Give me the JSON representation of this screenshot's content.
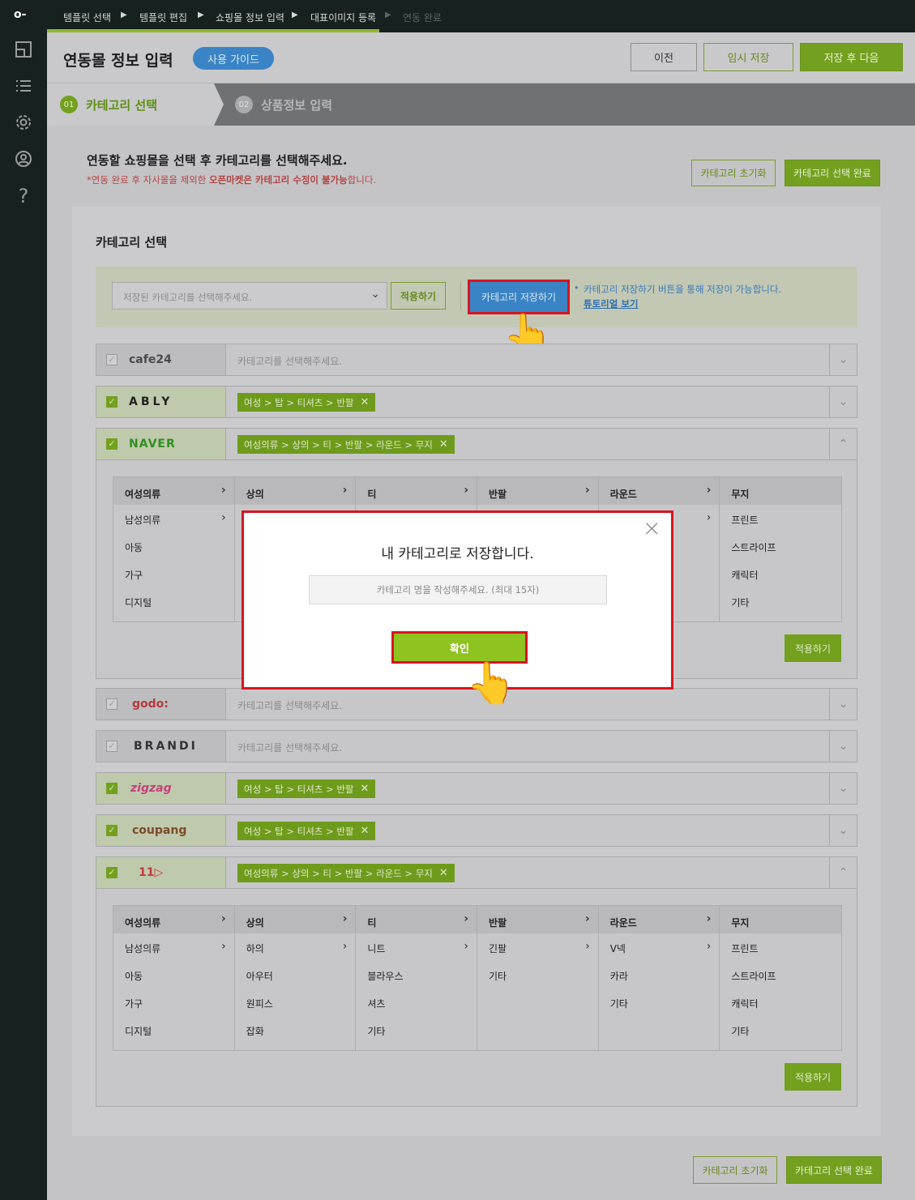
{
  "sidebar": {
    "logo": "o-",
    "icons": [
      "layout-icon",
      "list-icon",
      "gear-icon",
      "user-circle-icon",
      "help-icon"
    ]
  },
  "breadcrumb": {
    "steps": [
      "템플릿 선택",
      "템플릿 편집",
      "쇼핑몰 정보 입력",
      "대표이미지 등록",
      "연동 완료"
    ],
    "sep": "▶"
  },
  "header": {
    "title": "연동몰 정보 입력",
    "guide": "사용 가이드",
    "prev": "이전",
    "temp_save": "임시 저장",
    "save_next": "저장 후 다음"
  },
  "steps": {
    "s1_num": "01",
    "s1_label": "카테고리 선택",
    "s2_num": "02",
    "s2_label": "상품정보 입력"
  },
  "intro": {
    "title": "연동할 쇼핑몰을 선택 후 카테고리를 선택해주세요.",
    "note_pre": "*연동 완료 후 자사몰을 제외한 ",
    "note_b1": "오픈마켓은",
    "note_b2": " 카테고리 수정이 불가능",
    "note_post": "합니다.",
    "reset": "카테고리 초기화",
    "complete": "카테고리 선택 완료"
  },
  "panel": {
    "title": "카테고리 선택",
    "select_placeholder": "저장된 카테고리를 선택해주세요.",
    "apply": "적용하기",
    "save_cat": "카테고리 저장하기",
    "hint": "카테고리 저장하기 버튼을 통해 저장이 가능합니다.",
    "tutorial": "튜토리얼 보기"
  },
  "malls": [
    {
      "name": "cafe24",
      "checked": false,
      "value": "카테고리를 선택해주세요."
    },
    {
      "name": "ABLY",
      "checked": true,
      "value": "여성 > 탑 > 티셔츠 > 반팔"
    },
    {
      "name": "NAVER",
      "checked": true,
      "value": "여성의류 > 상의 > 티 > 반팔 > 라운드 > 무지"
    },
    {
      "name": "godo:",
      "checked": false,
      "value": "카테고리를 선택해주세요."
    },
    {
      "name": "BRANDI",
      "checked": false,
      "value": "카테고리를 선택해주세요."
    },
    {
      "name": "zigzag",
      "checked": true,
      "value": "여성 > 탑 > 티셔츠 > 반팔"
    },
    {
      "name": "coupang",
      "checked": true,
      "value": "여성 > 탑 > 티셔츠 > 반팔"
    },
    {
      "name": "11",
      "checked": true,
      "value": "여성의류 > 상의 > 티 > 반팔 > 라운드 > 무지"
    }
  ],
  "category_grid": {
    "headers": [
      "여성의류",
      "상의",
      "티",
      "반팔",
      "라운드",
      "무지"
    ],
    "columns": [
      [
        "남성의류",
        "아동",
        "가구",
        "디지털"
      ],
      [
        "하의",
        "아우터",
        "원피스",
        "잡화"
      ],
      [
        "니트",
        "블라우스",
        "셔츠",
        "기타"
      ],
      [
        "긴팔",
        "기타"
      ],
      [
        "V넥",
        "카라",
        "기타"
      ],
      [
        "프린트",
        "스트라이프",
        "캐릭터",
        "기타"
      ]
    ]
  },
  "modal": {
    "title": "내 카테고리로 저장합니다.",
    "placeholder": "카테고리 명을 작성해주세요. (최대 15자)",
    "confirm": "확인",
    "close": "×"
  },
  "footer": {
    "reset": "카테고리 초기화",
    "complete": "카테고리 선택 완료"
  },
  "colors": {
    "accent": "#8fc31f",
    "blue": "#3a8fd8",
    "highlight": "#d8141e"
  }
}
